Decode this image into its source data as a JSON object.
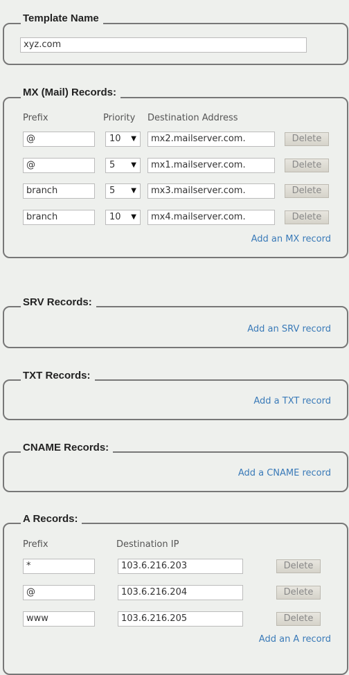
{
  "template": {
    "legend": "Template Name",
    "value": "xyz.com"
  },
  "mx": {
    "legend": "MX (Mail) Records:",
    "headers": {
      "prefix": "Prefix",
      "priority": "Priority",
      "destination": "Destination Address"
    },
    "rows": [
      {
        "prefix": "@",
        "priority": "10",
        "destination": "mx2.mailserver.com."
      },
      {
        "prefix": "@",
        "priority": "5",
        "destination": "mx1.mailserver.com."
      },
      {
        "prefix": "branch",
        "priority": "5",
        "destination": "mx3.mailserver.com."
      },
      {
        "prefix": "branch",
        "priority": "10",
        "destination": "mx4.mailserver.com."
      }
    ],
    "delete_label": "Delete",
    "add_link": "Add an MX record"
  },
  "srv": {
    "legend": "SRV Records:",
    "add_link": "Add an SRV record"
  },
  "txt": {
    "legend": "TXT Records:",
    "add_link": "Add a TXT record"
  },
  "cname": {
    "legend": "CNAME Records:",
    "add_link": "Add a CNAME record"
  },
  "a": {
    "legend": "A Records:",
    "headers": {
      "prefix": "Prefix",
      "ip": "Destination IP"
    },
    "rows": [
      {
        "prefix": "*",
        "ip": "103.6.216.203"
      },
      {
        "prefix": "@",
        "ip": "103.6.216.204"
      },
      {
        "prefix": "www",
        "ip": "103.6.216.205"
      }
    ],
    "delete_label": "Delete",
    "add_link": "Add an A record"
  },
  "colors": {
    "background": "#eef0ed",
    "link": "#3a7ab8"
  }
}
